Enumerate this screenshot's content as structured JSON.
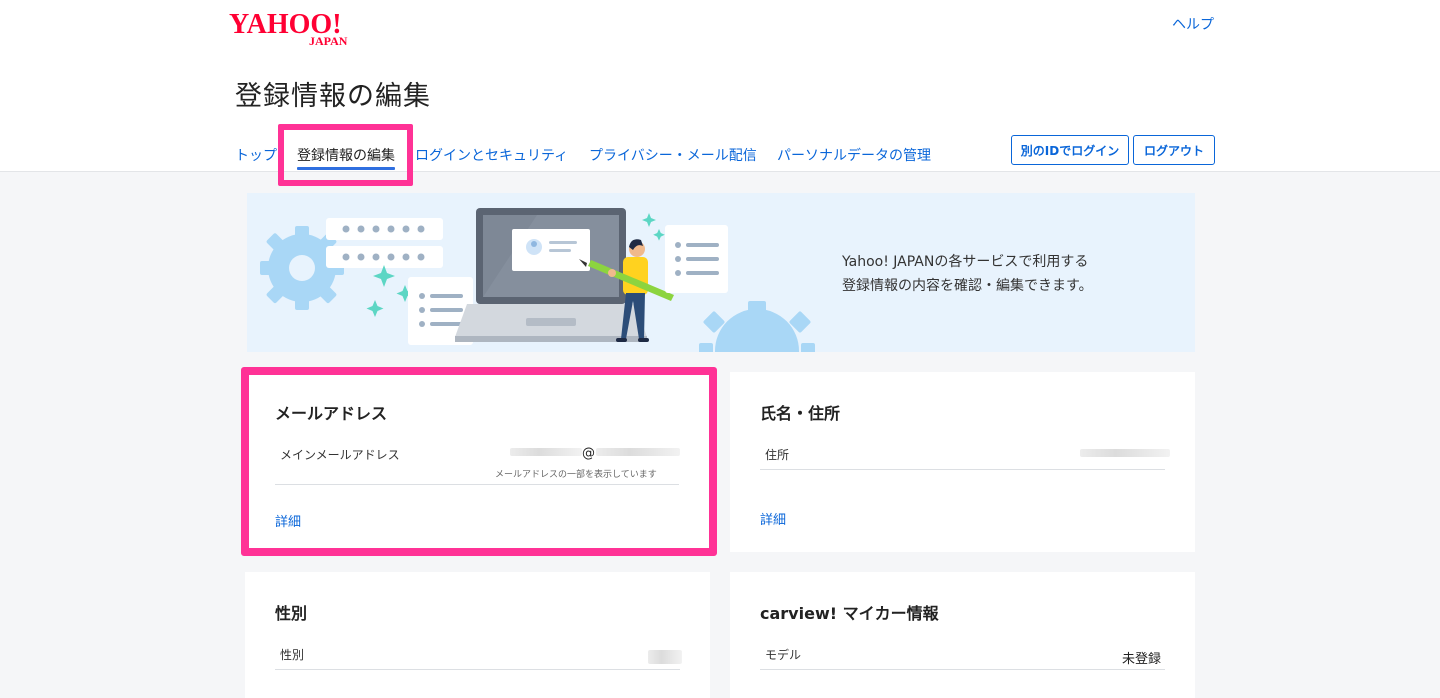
{
  "header": {
    "logo_text": "YAHOO! JAPAN",
    "help_label": "ヘルプ",
    "page_title": "登録情報の編集",
    "tabs": [
      {
        "label": "トップ",
        "active": false
      },
      {
        "label": "登録情報の編集",
        "active": true
      },
      {
        "label": "ログインとセキュリティ",
        "active": false
      },
      {
        "label": "プライバシー・メール配信",
        "active": false
      },
      {
        "label": "パーソナルデータの管理",
        "active": false
      }
    ],
    "login_other_label": "別のIDでログイン",
    "logout_label": "ログアウト"
  },
  "banner": {
    "line1": "Yahoo! JAPANの各サービスで利用する",
    "line2": "登録情報の内容を確認・編集できます。"
  },
  "cards": {
    "email": {
      "title": "メールアドレス",
      "row_label": "メインメールアドレス",
      "at_sign": "@",
      "note": "メールアドレスの一部を表示しています",
      "detail": "詳細"
    },
    "name_address": {
      "title": "氏名・住所",
      "row_label": "住所",
      "detail": "詳細"
    },
    "gender": {
      "title": "性別",
      "row_label": "性別"
    },
    "carview": {
      "title": "carview! マイカー情報",
      "row_label": "モデル",
      "row_value": "未登録"
    }
  },
  "colors": {
    "link": "#0a66d9",
    "highlight": "#ff3296",
    "logo_red": "#ff0033",
    "banner_bg": "#e8f3fd"
  },
  "icons": [
    "yahoo-logo",
    "gear-icon",
    "laptop-icon",
    "person-illustration",
    "sparkle-icon"
  ]
}
